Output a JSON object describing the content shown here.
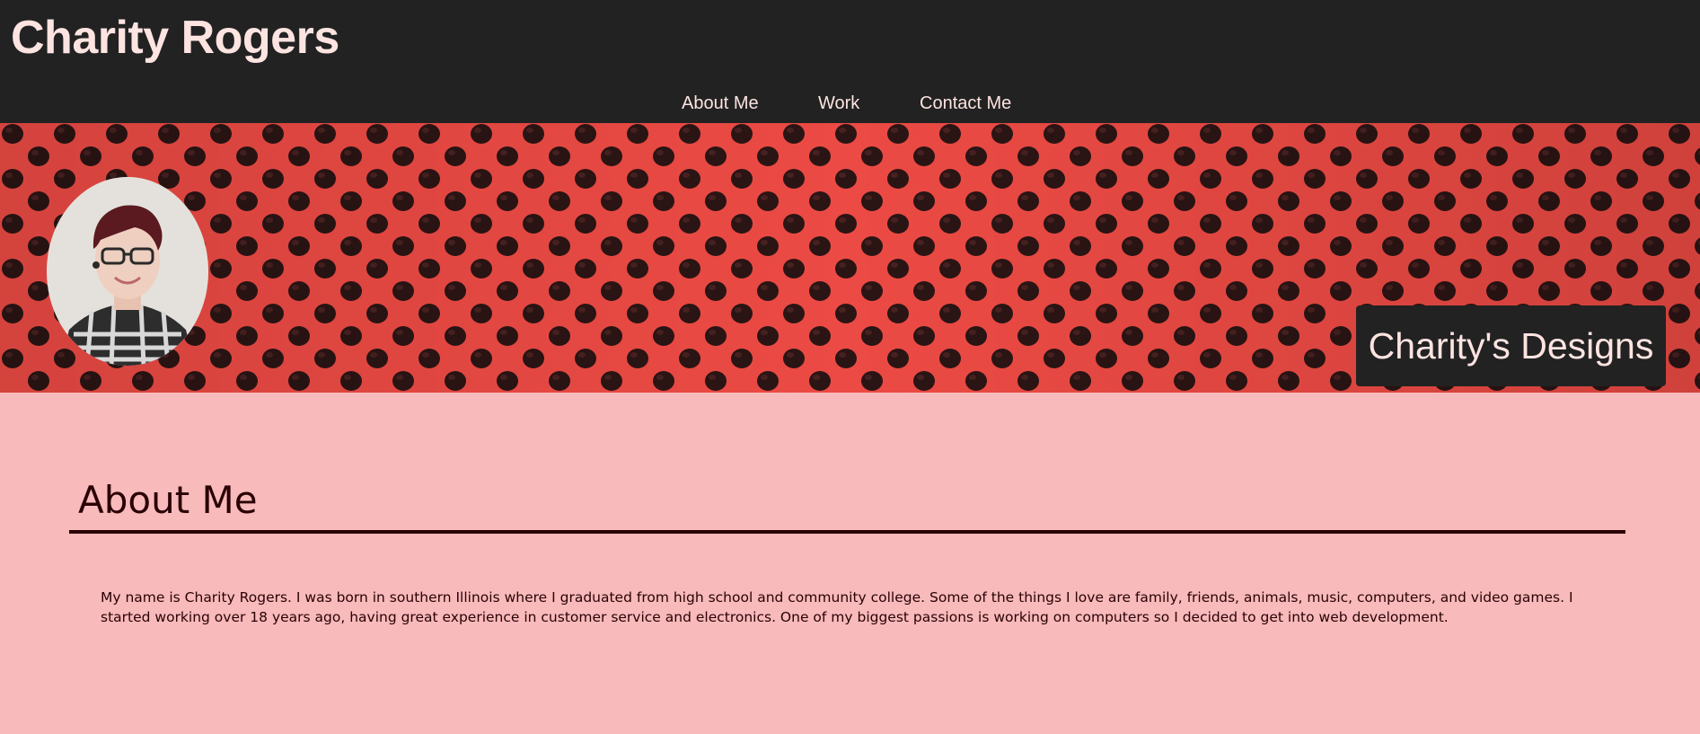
{
  "header": {
    "site_title": "Charity Rogers",
    "nav": [
      {
        "label": "About Me"
      },
      {
        "label": "Work"
      },
      {
        "label": "Contact Me"
      }
    ]
  },
  "hero": {
    "avatar_icon": "profile-photo",
    "brand_label": "Charity's Designs"
  },
  "about": {
    "heading": "About Me",
    "body": "My name is Charity Rogers. I was born in southern Illinois where I graduated from high school and community college. Some of the things I love are family, friends, animals, music, computers, and video games. I started working over 18 years ago, having great experience in customer service and electronics. One of my biggest passions is working on computers so I decided to get into web development."
  },
  "colors": {
    "header_bg": "#222222",
    "header_text": "#fde4e1",
    "page_bg": "#f8babb",
    "body_text": "#2a0205",
    "hero_red": "#e8453f"
  }
}
